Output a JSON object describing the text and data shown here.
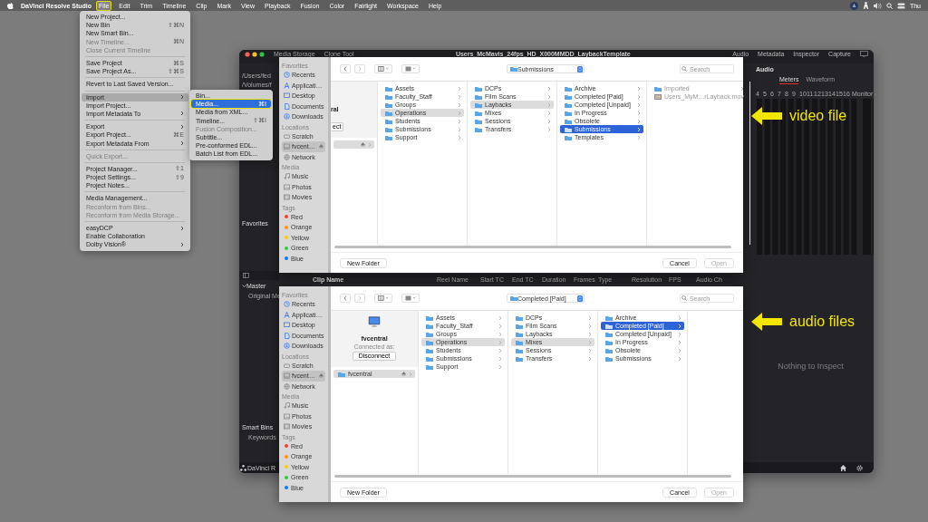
{
  "menu_bar": {
    "app": "DaVinci Resolve Studio",
    "menus": [
      {
        "label": "File",
        "selected": true,
        "callout": true
      },
      {
        "label": "Edit",
        "selected": false,
        "callout": false
      },
      {
        "label": "Trim",
        "selected": false,
        "callout": false
      },
      {
        "label": "Timeline",
        "selected": false,
        "callout": false
      },
      {
        "label": "Clip",
        "selected": false,
        "callout": false
      },
      {
        "label": "Mark",
        "selected": false,
        "callout": false
      },
      {
        "label": "View",
        "selected": false,
        "callout": false
      },
      {
        "label": "Playback",
        "selected": false,
        "callout": false
      },
      {
        "label": "Fusion",
        "selected": false,
        "callout": false
      },
      {
        "label": "Color",
        "selected": false,
        "callout": false
      },
      {
        "label": "Fairlight",
        "selected": false,
        "callout": false
      },
      {
        "label": "Workspace",
        "selected": false,
        "callout": false
      },
      {
        "label": "Help",
        "selected": false,
        "callout": false
      }
    ],
    "clock": "Thu"
  },
  "file_menu": {
    "items": [
      {
        "kind": "item",
        "label": "New Project...",
        "disabled": false,
        "submenu": false,
        "selected": false
      },
      {
        "kind": "item",
        "label": "New Bin",
        "shortcut": "⇧⌘N",
        "disabled": false,
        "submenu": false,
        "selected": false
      },
      {
        "kind": "item",
        "label": "New Smart Bin...",
        "disabled": false,
        "submenu": false,
        "selected": false
      },
      {
        "kind": "item",
        "label": "New Timeline...",
        "shortcut": "⌘N",
        "disabled": true,
        "submenu": false,
        "selected": false
      },
      {
        "kind": "item",
        "label": "Close Current Timeline",
        "disabled": true,
        "submenu": false,
        "selected": false
      },
      {
        "kind": "separator"
      },
      {
        "kind": "item",
        "label": "Save Project",
        "shortcut": "⌘S",
        "disabled": false,
        "submenu": false,
        "selected": false
      },
      {
        "kind": "item",
        "label": "Save Project As...",
        "shortcut": "⇧⌘S",
        "disabled": false,
        "submenu": false,
        "selected": false
      },
      {
        "kind": "separator"
      },
      {
        "kind": "item",
        "label": "Revert to Last Saved Version...",
        "disabled": false,
        "submenu": false,
        "selected": false
      },
      {
        "kind": "separator"
      },
      {
        "kind": "item",
        "label": "Import",
        "disabled": false,
        "submenu": true,
        "selected": true
      },
      {
        "kind": "item",
        "label": "Import Project...",
        "disabled": false,
        "submenu": false,
        "selected": false
      },
      {
        "kind": "item",
        "label": "Import Metadata To",
        "disabled": false,
        "submenu": true,
        "selected": false
      },
      {
        "kind": "separator"
      },
      {
        "kind": "item",
        "label": "Export",
        "disabled": false,
        "submenu": true,
        "selected": false
      },
      {
        "kind": "item",
        "label": "Export Project...",
        "shortcut": "⌘E",
        "disabled": false,
        "submenu": false,
        "selected": false
      },
      {
        "kind": "item",
        "label": "Export Metadata From",
        "disabled": false,
        "submenu": true,
        "selected": false
      },
      {
        "kind": "separator"
      },
      {
        "kind": "item",
        "label": "Quick Export...",
        "disabled": true,
        "submenu": false,
        "selected": false
      },
      {
        "kind": "separator"
      },
      {
        "kind": "item",
        "label": "Project Manager...",
        "shortcut": "⇧1",
        "disabled": false,
        "submenu": false,
        "selected": false
      },
      {
        "kind": "item",
        "label": "Project Settings...",
        "shortcut": "⇧9",
        "disabled": false,
        "submenu": false,
        "selected": false
      },
      {
        "kind": "item",
        "label": "Project Notes...",
        "disabled": false,
        "submenu": false,
        "selected": false
      },
      {
        "kind": "separator"
      },
      {
        "kind": "item",
        "label": "Media Management...",
        "disabled": false,
        "submenu": false,
        "selected": false
      },
      {
        "kind": "item",
        "label": "Reconform from Bins...",
        "disabled": true,
        "submenu": false,
        "selected": false
      },
      {
        "kind": "item",
        "label": "Reconform from Media Storage...",
        "disabled": true,
        "submenu": false,
        "selected": false
      },
      {
        "kind": "separator"
      },
      {
        "kind": "item",
        "label": "easyDCP",
        "disabled": false,
        "submenu": true,
        "selected": false
      },
      {
        "kind": "item",
        "label": "Enable Collaboration",
        "disabled": false,
        "submenu": false,
        "selected": false
      },
      {
        "kind": "item",
        "label": "Dolby Vision®",
        "disabled": false,
        "submenu": true,
        "selected": false
      }
    ]
  },
  "import_submenu": {
    "items": [
      {
        "label": "Bin...",
        "disabled": false,
        "selected": false,
        "callout": false
      },
      {
        "label": "Media...",
        "shortcut": "⌘I",
        "disabled": false,
        "selected": true,
        "callout": true
      },
      {
        "label": "Media from XML...",
        "disabled": false,
        "selected": false,
        "callout": false
      },
      {
        "label": "Timeline...",
        "shortcut": "⇧⌘I",
        "disabled": false,
        "selected": false,
        "callout": false
      },
      {
        "label": "Fusion Composition...",
        "disabled": true,
        "selected": false,
        "callout": false
      },
      {
        "label": "Subtitle...",
        "disabled": false,
        "selected": false,
        "callout": false
      },
      {
        "label": "Pre-conformed EDL...",
        "disabled": false,
        "selected": false,
        "callout": false
      },
      {
        "label": "Batch List from EDL...",
        "disabled": false,
        "selected": false,
        "callout": false
      }
    ]
  },
  "resolve_window": {
    "tabs": [
      {
        "label": "Media Storage"
      },
      {
        "label": "Clone Tool"
      }
    ],
    "title": "Users_McMavis_24fps_HD_X000MMDD_LaybackTemplate",
    "panel_tabs": [
      {
        "label": "Audio"
      },
      {
        "label": "Metadata"
      },
      {
        "label": "Inspector"
      },
      {
        "label": "Capture"
      }
    ],
    "locations": [
      {
        "label": "/Users/fed"
      },
      {
        "label": "/Volumes/f"
      }
    ],
    "favorites_label": "Favorites",
    "bins": [
      {
        "label": "Master",
        "expanded": true,
        "children": [
          {
            "label": "Original Me"
          }
        ]
      }
    ],
    "smart_bins": {
      "label": "Smart Bins",
      "children": [
        {
          "label": "Keywords"
        }
      ]
    },
    "table_columns": [
      "Clip Name",
      "Reel Name",
      "Start TC",
      "End TC",
      "Duration",
      "Frames",
      "Type",
      "Resolution",
      "FPS",
      "Audio Ch"
    ],
    "audio": {
      "title": "Audio",
      "tabs": [
        {
          "label": "Meters",
          "selected": true
        },
        {
          "label": "Waveform",
          "selected": false
        }
      ],
      "channels": [
        "4",
        "5",
        "6",
        "7",
        "8",
        "9",
        "10",
        "11",
        "12",
        "13",
        "14",
        "15",
        "16"
      ],
      "monitor": "Monitor"
    },
    "inspector_message": "Nothing to Inspect",
    "logo_text": "DaVinci R"
  },
  "dialogs": [
    {
      "path": "Submissions",
      "search_placeholder": "Search",
      "sidebar": [
        {
          "kind": "header",
          "label": "Favorites"
        },
        {
          "kind": "place",
          "label": "Recents",
          "selected": false
        },
        {
          "kind": "place",
          "label": "Applicati…",
          "selected": false
        },
        {
          "kind": "place",
          "label": "Desktop",
          "selected": false
        },
        {
          "kind": "place",
          "label": "Documents",
          "selected": false
        },
        {
          "kind": "place",
          "label": "Downloads",
          "selected": false
        },
        {
          "kind": "header",
          "label": "Locations"
        },
        {
          "kind": "place",
          "label": "Scratch",
          "selected": false
        },
        {
          "kind": "volume",
          "label": "fvcent…",
          "selected": true
        },
        {
          "kind": "place",
          "label": "Network",
          "selected": false
        },
        {
          "kind": "header",
          "label": "Media"
        },
        {
          "kind": "place",
          "label": "Music",
          "selected": false
        },
        {
          "kind": "place",
          "label": "Photos",
          "selected": false
        },
        {
          "kind": "place",
          "label": "Movies",
          "selected": false
        },
        {
          "kind": "header",
          "label": "Tags"
        },
        {
          "kind": "tag",
          "label": "Red",
          "color": "#ff3b30"
        },
        {
          "kind": "tag",
          "label": "Orange",
          "color": "#ff9500"
        },
        {
          "kind": "tag",
          "label": "Yellow",
          "color": "#ffcc00"
        },
        {
          "kind": "tag",
          "label": "Green",
          "color": "#28cd41"
        },
        {
          "kind": "tag",
          "label": "Blue",
          "color": "#007aff"
        }
      ],
      "server": {
        "partial": true,
        "name": "ral",
        "button": "ect",
        "items": [
          {
            "selected": true
          }
        ]
      },
      "columns": [
        {
          "items": [
            {
              "kind": "folder",
              "label": "Assets",
              "selected": false,
              "active": false,
              "disabled": false
            },
            {
              "kind": "folder",
              "label": "Faculty_Staff",
              "selected": false,
              "active": false,
              "disabled": false
            },
            {
              "kind": "folder",
              "label": "Groups",
              "selected": false,
              "active": false,
              "disabled": false
            },
            {
              "kind": "folder",
              "label": "Operations",
              "selected": true,
              "active": false,
              "disabled": false
            },
            {
              "kind": "folder",
              "label": "Students",
              "selected": false,
              "active": false,
              "disabled": false
            },
            {
              "kind": "folder",
              "label": "Submissions",
              "selected": false,
              "active": false,
              "disabled": false
            },
            {
              "kind": "folder",
              "label": "Support",
              "selected": false,
              "active": false,
              "disabled": false
            }
          ]
        },
        {
          "items": [
            {
              "kind": "folder",
              "label": "DCPs",
              "selected": false,
              "active": false,
              "disabled": false
            },
            {
              "kind": "folder",
              "label": "Film Scans",
              "selected": false,
              "active": false,
              "disabled": false
            },
            {
              "kind": "folder",
              "label": "Laybacks",
              "selected": true,
              "active": false,
              "disabled": false
            },
            {
              "kind": "folder",
              "label": "Mixes",
              "selected": false,
              "active": false,
              "disabled": false
            },
            {
              "kind": "folder",
              "label": "Sessions",
              "selected": false,
              "active": false,
              "disabled": false
            },
            {
              "kind": "folder",
              "label": "Transfers",
              "selected": false,
              "active": false,
              "disabled": false
            }
          ]
        },
        {
          "items": [
            {
              "kind": "folder",
              "label": "Archive",
              "selected": false,
              "active": false,
              "disabled": false
            },
            {
              "kind": "folder",
              "label": "Completed [Paid]",
              "selected": false,
              "active": false,
              "disabled": false
            },
            {
              "kind": "folder",
              "label": "Completed [Unpaid]",
              "selected": false,
              "active": false,
              "disabled": false
            },
            {
              "kind": "folder",
              "label": "In Progress",
              "selected": false,
              "active": false,
              "disabled": false
            },
            {
              "kind": "folder",
              "label": "Obsolete",
              "selected": false,
              "active": false,
              "disabled": false
            },
            {
              "kind": "folder",
              "label": "Submissions",
              "selected": true,
              "active": true,
              "disabled": false
            },
            {
              "kind": "folder",
              "label": "Templates",
              "selected": false,
              "active": false,
              "disabled": false
            }
          ]
        },
        {
          "items": [
            {
              "kind": "folder",
              "label": "Imported",
              "selected": false,
              "active": false,
              "disabled": true
            },
            {
              "kind": "file",
              "label": "Users_MyM…rLayback.mov",
              "selected": false,
              "active": false,
              "disabled": true
            }
          ]
        }
      ],
      "buttons": {
        "new_folder": "New Folder",
        "cancel": "Cancel",
        "open": {
          "label": "Open",
          "disabled": true
        }
      }
    },
    {
      "path": "Completed [Paid]",
      "search_placeholder": "Search",
      "sidebar": [
        {
          "kind": "header",
          "label": "Favorites"
        },
        {
          "kind": "place",
          "label": "Recents",
          "selected": false
        },
        {
          "kind": "place",
          "label": "Applicati…",
          "selected": false
        },
        {
          "kind": "place",
          "label": "Desktop",
          "selected": false
        },
        {
          "kind": "place",
          "label": "Documents",
          "selected": false
        },
        {
          "kind": "place",
          "label": "Downloads",
          "selected": false
        },
        {
          "kind": "header",
          "label": "Locations"
        },
        {
          "kind": "place",
          "label": "Scratch",
          "selected": false
        },
        {
          "kind": "volume",
          "label": "fvcent…",
          "selected": true
        },
        {
          "kind": "place",
          "label": "Network",
          "selected": false
        },
        {
          "kind": "header",
          "label": "Media"
        },
        {
          "kind": "place",
          "label": "Music",
          "selected": false
        },
        {
          "kind": "place",
          "label": "Photos",
          "selected": false
        },
        {
          "kind": "place",
          "label": "Movies",
          "selected": false
        },
        {
          "kind": "header",
          "label": "Tags"
        },
        {
          "kind": "tag",
          "label": "Red",
          "color": "#ff3b30"
        },
        {
          "kind": "tag",
          "label": "Orange",
          "color": "#ff9500"
        },
        {
          "kind": "tag",
          "label": "Yellow",
          "color": "#ffcc00"
        },
        {
          "kind": "tag",
          "label": "Green",
          "color": "#28cd41"
        },
        {
          "kind": "tag",
          "label": "Blue",
          "color": "#007aff"
        }
      ],
      "server": {
        "partial": false,
        "name": "fvcentral",
        "status": "Connected as:",
        "button": "Disconnect",
        "items": [
          {
            "label": "fvcentral",
            "selected": true
          }
        ]
      },
      "columns": [
        {
          "items": [
            {
              "kind": "folder",
              "label": "Assets",
              "selected": false,
              "active": false,
              "disabled": false
            },
            {
              "kind": "folder",
              "label": "Faculty_Staff",
              "selected": false,
              "active": false,
              "disabled": false
            },
            {
              "kind": "folder",
              "label": "Groups",
              "selected": false,
              "active": false,
              "disabled": false
            },
            {
              "kind": "folder",
              "label": "Operations",
              "selected": true,
              "active": false,
              "disabled": false
            },
            {
              "kind": "folder",
              "label": "Students",
              "selected": false,
              "active": false,
              "disabled": false
            },
            {
              "kind": "folder",
              "label": "Submissions",
              "selected": false,
              "active": false,
              "disabled": false
            },
            {
              "kind": "folder",
              "label": "Support",
              "selected": false,
              "active": false,
              "disabled": false
            }
          ]
        },
        {
          "items": [
            {
              "kind": "folder",
              "label": "DCPs",
              "selected": false,
              "active": false,
              "disabled": false
            },
            {
              "kind": "folder",
              "label": "Film Scans",
              "selected": false,
              "active": false,
              "disabled": false
            },
            {
              "kind": "folder",
              "label": "Laybacks",
              "selected": false,
              "active": false,
              "disabled": false
            },
            {
              "kind": "folder",
              "label": "Mixes",
              "selected": true,
              "active": false,
              "disabled": false
            },
            {
              "kind": "folder",
              "label": "Sessions",
              "selected": false,
              "active": false,
              "disabled": false
            },
            {
              "kind": "folder",
              "label": "Transfers",
              "selected": false,
              "active": false,
              "disabled": false
            }
          ]
        },
        {
          "items": [
            {
              "kind": "folder",
              "label": "Archive",
              "selected": false,
              "active": false,
              "disabled": false
            },
            {
              "kind": "folder",
              "label": "Completed [Paid]",
              "selected": true,
              "active": true,
              "disabled": false
            },
            {
              "kind": "folder",
              "label": "Completed [Unpaid]",
              "selected": false,
              "active": false,
              "disabled": false
            },
            {
              "kind": "folder",
              "label": "In Progress",
              "selected": false,
              "active": false,
              "disabled": false
            },
            {
              "kind": "folder",
              "label": "Obsolete",
              "selected": false,
              "active": false,
              "disabled": false
            },
            {
              "kind": "folder",
              "label": "Submissions",
              "selected": false,
              "active": false,
              "disabled": false
            }
          ]
        }
      ],
      "buttons": {
        "new_folder": "New Folder",
        "cancel": "Cancel",
        "open": {
          "label": "Open",
          "disabled": true
        }
      }
    }
  ],
  "annotations": [
    {
      "text": "video file"
    },
    {
      "text": "audio files"
    }
  ]
}
